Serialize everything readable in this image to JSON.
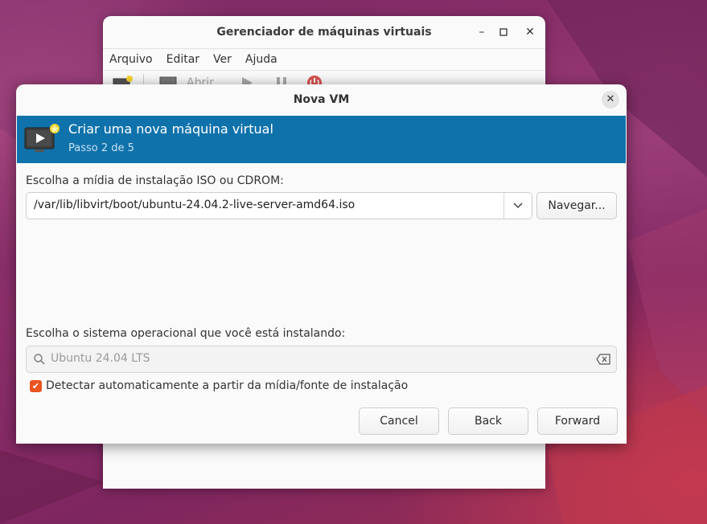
{
  "main_window": {
    "title": "Gerenciador de máquinas virtuais",
    "menu": [
      "Arquivo",
      "Editar",
      "Ver",
      "Ajuda"
    ],
    "toolbar": {
      "open_label": "Abrir"
    }
  },
  "dialog": {
    "title": "Nova VM",
    "banner": {
      "title": "Criar uma nova máquina virtual",
      "subtitle": "Passo 2 de 5"
    },
    "media_label": "Escolha a mídia de instalação ISO ou CDROM:",
    "media_value": "/var/lib/libvirt/boot/ubuntu-24.04.2-live-server-amd64.iso",
    "browse_label": "Navegar...",
    "os_label": "Escolha o sistema operacional que você está instalando:",
    "os_value": "Ubuntu 24.04 LTS",
    "autodetect_label": "Detectar automaticamente a partir da mídia/fonte de instalação",
    "autodetect_checked": true,
    "buttons": {
      "cancel": "Cancel",
      "back": "Back",
      "forward": "Forward"
    }
  },
  "colors": {
    "banner": "#0f72ab",
    "checkbox_accent": "#e95420",
    "desktop": "#7e2660"
  }
}
